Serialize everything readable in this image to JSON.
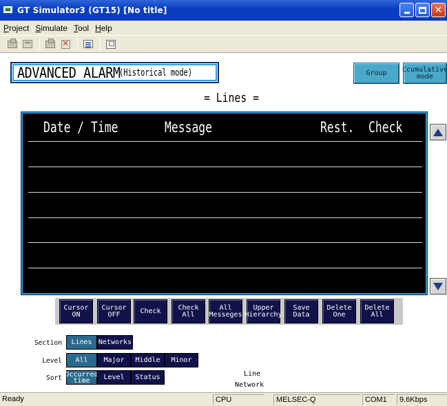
{
  "window": {
    "title": "GT Simulator3 (GT15)  [No title]",
    "controls": [
      "minimize",
      "maximize",
      "close"
    ]
  },
  "menu": [
    {
      "label": "Project",
      "underline": "P",
      "rest": "roject"
    },
    {
      "label": "Simulate",
      "underline": "S",
      "rest": "imulate"
    },
    {
      "label": "Tool",
      "underline": "T",
      "rest": "ool"
    },
    {
      "label": "Help",
      "underline": "H",
      "rest": "elp"
    }
  ],
  "toolbar": {
    "icons": [
      "open-project-icon",
      "open-folder-icon",
      "connect-icon",
      "disconnect-icon",
      "list-icon",
      "properties-icon"
    ]
  },
  "screen": {
    "alarm_title": "ADVANCED ALARM",
    "alarm_mode": "(Historical mode)",
    "group_button": "Group",
    "cumulative_button_line1": "Ccumulative",
    "cumulative_button_line2": "mode",
    "lines_label": "= Lines =",
    "table": {
      "columns": [
        "Date / Time",
        "Message",
        "Rest.",
        "Check"
      ],
      "rows": []
    },
    "command_buttons": [
      {
        "line1": "Cursor",
        "line2": "ON"
      },
      {
        "line1": "Cursor",
        "line2": "OFF"
      },
      {
        "line1": "Check",
        "line2": ""
      },
      {
        "line1": "Check",
        "line2": "All"
      },
      {
        "line1": "All",
        "line2": "Messeges"
      },
      {
        "line1": "Upper",
        "line2": "Hierarchy"
      },
      {
        "line1": "Save",
        "line2": "Data"
      },
      {
        "line1": "Delete",
        "line2": "One"
      },
      {
        "line1": "Delete",
        "line2": "All"
      }
    ],
    "section": {
      "label": "Section",
      "options": [
        "Lines",
        "Networks"
      ],
      "selected": "Lines"
    },
    "level": {
      "label": "Level",
      "options": [
        "All",
        "Major",
        "Middle",
        "Minor"
      ],
      "selected": "All"
    },
    "sort": {
      "label": "Sort",
      "options": [
        {
          "line1": "Occurred",
          "line2": "time"
        },
        {
          "line1": "Level",
          "line2": ""
        },
        {
          "line1": "Status",
          "line2": ""
        }
      ],
      "selected": "Occurred time"
    },
    "line_label": "Line",
    "network_label": "Network"
  },
  "status": {
    "ready": "Ready",
    "cpu": "CPU",
    "plc": "MELSEC-Q",
    "port": "COM1",
    "speed": "9.6Kbps"
  },
  "colors": {
    "title_bar": "#0a3fc4",
    "selected_option": "#2b6a8c",
    "dark_button": "#12124a",
    "panel_button": "#4aa8c8",
    "table_border": "#2a9ad6"
  }
}
